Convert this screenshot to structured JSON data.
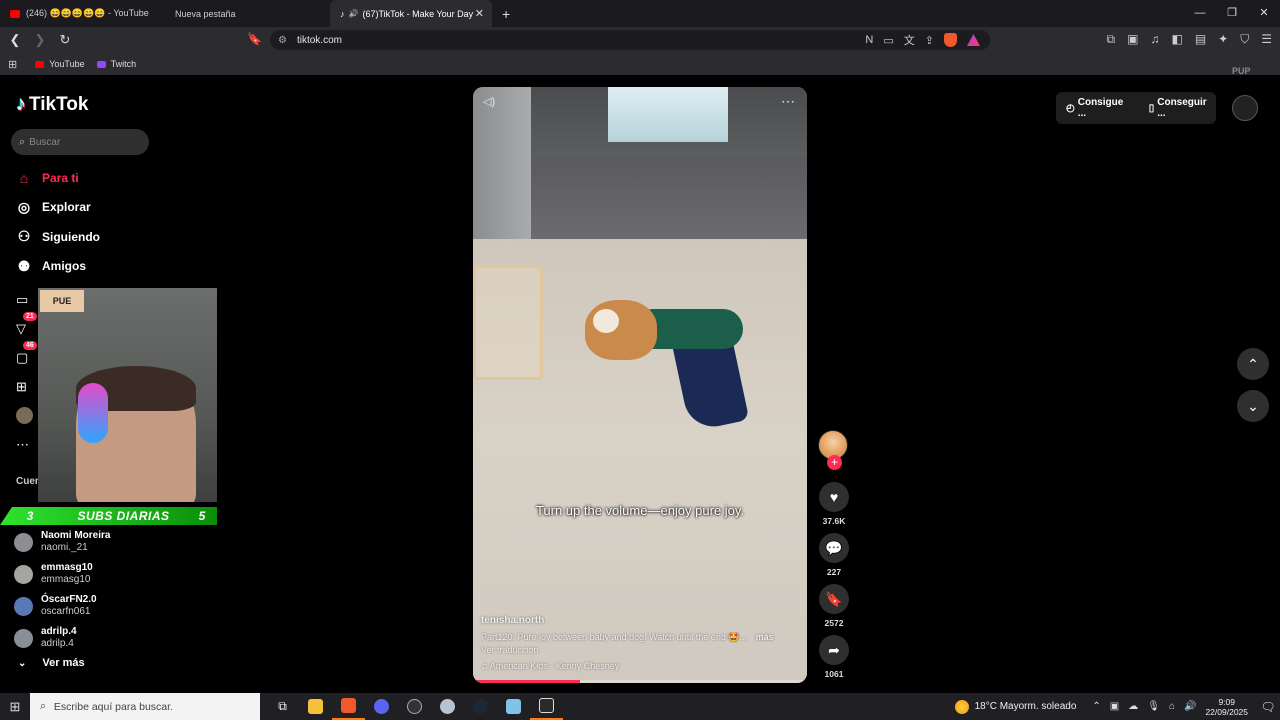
{
  "browser": {
    "tabs": [
      {
        "label": "(246) 😄😄😄😄😄 - YouTube",
        "color": "#ff0000"
      },
      {
        "label": "Nueva pestaña",
        "color": ""
      },
      {
        "label": "(67)TikTok - Make Your Day",
        "color": "#ffffff",
        "active": true
      }
    ],
    "url": "tiktok.com",
    "bookmarks": [
      {
        "label": "YouTube",
        "color": "#ff0000"
      },
      {
        "label": "Twitch",
        "color": "#9146ff"
      }
    ]
  },
  "sidebar": {
    "logo": "TikTok",
    "search_placeholder": "Buscar",
    "nav": [
      {
        "label": "Para ti",
        "icon": "home-icon"
      },
      {
        "label": "Explorar",
        "icon": "compass-icon"
      },
      {
        "label": "Siguiendo",
        "icon": "following-icon"
      },
      {
        "label": "Amigos",
        "icon": "friends-icon"
      }
    ],
    "badges": {
      "activity": "21",
      "messages": "46"
    },
    "accounts_heading": "Cuen",
    "accounts": [
      {
        "name": "Naomi Moreira",
        "handle": "naomi._21"
      },
      {
        "name": "emmasg10",
        "handle": "emmasg10"
      },
      {
        "name": "ÓscarFN2.0",
        "handle": "oscarfn061"
      },
      {
        "name": "adrilp.4",
        "handle": "adrilp.4"
      }
    ],
    "see_more": "Ver más"
  },
  "overlay": {
    "sign_text": "PUE",
    "subs_left": "3",
    "subs_label": "SUBS DIARIAS",
    "subs_right": "5"
  },
  "video": {
    "caption": "Turn up the volume—enjoy pure joy.",
    "author": "tenisha.north",
    "description": "Part120: Pure joy between baby and dog! Watch until the end 🤩...",
    "more": "más",
    "translate": "Ver traducción",
    "music": "♫ American Kids - Kenny Chesney",
    "progress": 0.32
  },
  "actions": {
    "likes": "37.6K",
    "comments": "227",
    "saves": "2572",
    "shares": "1061"
  },
  "topright": {
    "btn1": "Consigue ...",
    "btn2": "Conseguir ...",
    "pup": "PUP"
  },
  "taskbar": {
    "search_placeholder": "Escribe aquí para buscar.",
    "weather": "18°C  Mayorm. soleado",
    "time": "9:09",
    "date": "22/09/2025"
  }
}
